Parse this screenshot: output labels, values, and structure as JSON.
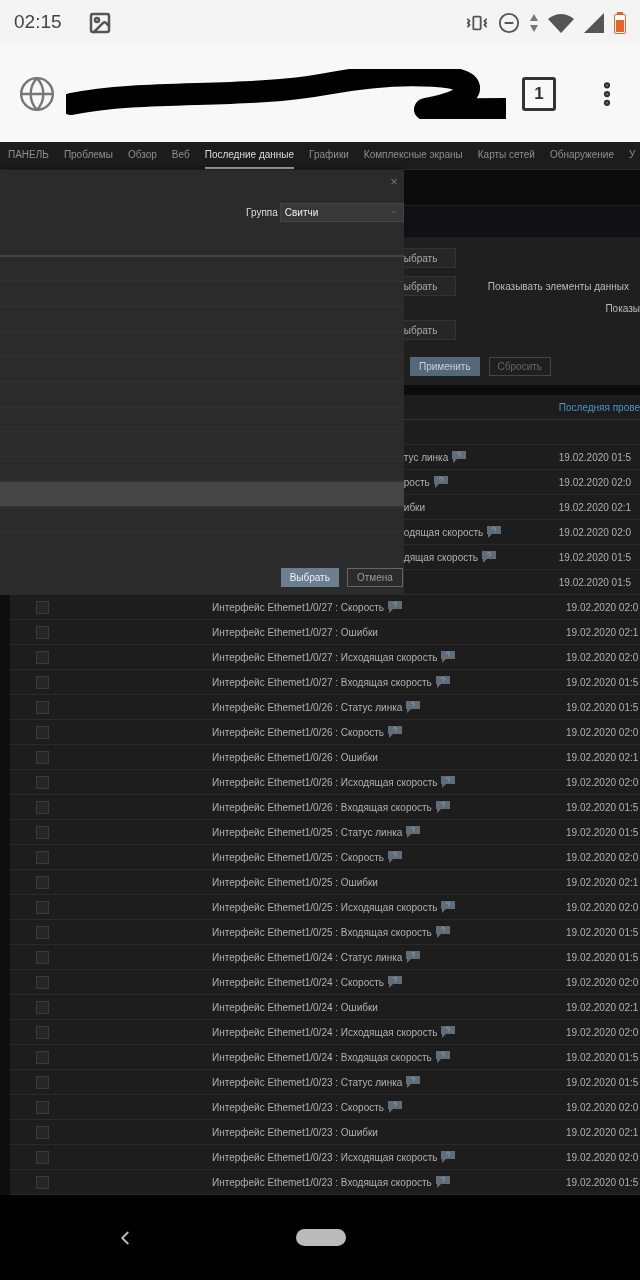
{
  "status_bar": {
    "time": "02:15"
  },
  "browser": {
    "tab_count": "1"
  },
  "nav": {
    "items": [
      {
        "label": "ПАНЕЛЬ",
        "selected": false
      },
      {
        "label": "Проблемы",
        "selected": false
      },
      {
        "label": "Обзор",
        "selected": false
      },
      {
        "label": "Веб",
        "selected": false
      },
      {
        "label": "Последние данные",
        "selected": true
      },
      {
        "label": "Графики",
        "selected": false
      },
      {
        "label": "Комплексные экраны",
        "selected": false
      },
      {
        "label": "Карты сетей",
        "selected": false
      },
      {
        "label": "Обнаружение",
        "selected": false
      },
      {
        "label": "У",
        "selected": false
      }
    ]
  },
  "modal": {
    "close": "×",
    "group_label": "Группа",
    "group_value": "Свитчи",
    "rows": [
      {
        "selected": false
      },
      {
        "selected": false
      },
      {
        "selected": false
      },
      {
        "selected": false
      },
      {
        "selected": false
      },
      {
        "selected": false
      },
      {
        "selected": false
      },
      {
        "selected": false
      },
      {
        "selected": false
      },
      {
        "selected": true
      },
      {
        "selected": false
      }
    ],
    "select_button": "Выбрать",
    "cancel_button": "Отмена"
  },
  "filter": {
    "select_buttons": [
      "ыбрать",
      "ыбрать",
      "ыбрать"
    ],
    "show_label": "Показывать элементы данных",
    "show_label_2": "Показы",
    "apply": "Применить",
    "reset": "Сбросить"
  },
  "table": {
    "last_check_header": "Последняя прове",
    "covered_rows": [
      {
        "item": "тус линка",
        "help": true,
        "time": "19.02.2020 01:5"
      },
      {
        "item": "рость",
        "help": true,
        "time": "19.02.2020 02:0"
      },
      {
        "item": "ибки",
        "help": false,
        "time": "19.02.2020 02:1"
      },
      {
        "item": "одящая скорость",
        "help": true,
        "time": "19.02.2020 02:0"
      },
      {
        "item": "дящая скорость",
        "help": true,
        "time": "19.02.2020 01:5"
      },
      {
        "help": false,
        "time": "19.02.2020 01:5"
      }
    ],
    "rows": [
      {
        "item": "Интерфейс Ethemet1/0/27 : Скорость",
        "help": true,
        "checked": false,
        "time": "19.02.2020 02:0"
      },
      {
        "item": "Интерфейс Ethemet1/0/27 : Ошибки",
        "help": false,
        "checked": false,
        "time": "19.02.2020 02:1"
      },
      {
        "item": "Интерфейс Ethemet1/0/27 : Исходящая скорость",
        "help": true,
        "checked": false,
        "time": "19.02.2020 02:0"
      },
      {
        "item": "Интерфейс Ethemet1/0/27 : Входящая скорость",
        "help": true,
        "checked": false,
        "time": "19.02.2020 01:5"
      },
      {
        "item": "Интерфейс Ethemet1/0/26 : Статус линка",
        "help": true,
        "checked": false,
        "time": "19.02.2020 01:5"
      },
      {
        "item": "Интерфейс Ethemet1/0/26 : Скорость",
        "help": true,
        "checked": false,
        "time": "19.02.2020 02:0"
      },
      {
        "item": "Интерфейс Ethemet1/0/26 : Ошибки",
        "help": false,
        "checked": false,
        "time": "19.02.2020 02:1"
      },
      {
        "item": "Интерфейс Ethemet1/0/26 : Исходящая скорость",
        "help": true,
        "checked": false,
        "time": "19.02.2020 02:0"
      },
      {
        "item": "Интерфейс Ethemet1/0/26 : Входящая скорость",
        "help": true,
        "checked": false,
        "time": "19.02.2020 01:5"
      },
      {
        "item": "Интерфейс Ethemet1/0/25 : Статус линка",
        "help": true,
        "checked": false,
        "time": "19.02.2020 01:5"
      },
      {
        "item": "Интерфейс Ethemet1/0/25 : Скорость",
        "help": true,
        "checked": false,
        "time": "19.02.2020 02:0"
      },
      {
        "item": "Интерфейс Ethemet1/0/25 : Ошибки",
        "help": false,
        "checked": false,
        "time": "19.02.2020 02:1"
      },
      {
        "item": "Интерфейс Ethemet1/0/25 : Исходящая скорость",
        "help": true,
        "checked": false,
        "time": "19.02.2020 02:0"
      },
      {
        "item": "Интерфейс Ethemet1/0/25 : Входящая скорость",
        "help": true,
        "checked": false,
        "time": "19.02.2020 01:5"
      },
      {
        "item": "Интерфейс Ethemet1/0/24 : Статус линка",
        "help": true,
        "checked": false,
        "time": "19.02.2020 01:5"
      },
      {
        "item": "Интерфейс Ethemet1/0/24 : Скорость",
        "help": true,
        "checked": false,
        "time": "19.02.2020 02:0"
      },
      {
        "item": "Интерфейс Ethemet1/0/24 : Ошибки",
        "help": false,
        "checked": false,
        "time": "19.02.2020 02:1"
      },
      {
        "item": "Интерфейс Ethemet1/0/24 : Исходящая скорость",
        "help": true,
        "checked": false,
        "time": "19.02.2020 02:0"
      },
      {
        "item": "Интерфейс Ethemet1/0/24 : Входящая скорость",
        "help": true,
        "checked": false,
        "time": "19.02.2020 01:5"
      },
      {
        "item": "Интерфейс Ethemet1/0/23 : Статус линка",
        "help": true,
        "checked": false,
        "time": "19.02.2020 01:5"
      },
      {
        "item": "Интерфейс Ethemet1/0/23 : Скорость",
        "help": true,
        "checked": false,
        "time": "19.02.2020 02:0"
      },
      {
        "item": "Интерфейс Ethemet1/0/23 : Ошибки",
        "help": false,
        "checked": false,
        "time": "19.02.2020 02:1"
      },
      {
        "item": "Интерфейс Ethemet1/0/23 : Исходящая скорость",
        "help": true,
        "checked": false,
        "time": "19.02.2020 02:0"
      },
      {
        "item": "Интерфейс Ethemet1/0/23 : Входящая скорость",
        "help": true,
        "checked": false,
        "time": "19.02.2020 01:5"
      }
    ]
  }
}
